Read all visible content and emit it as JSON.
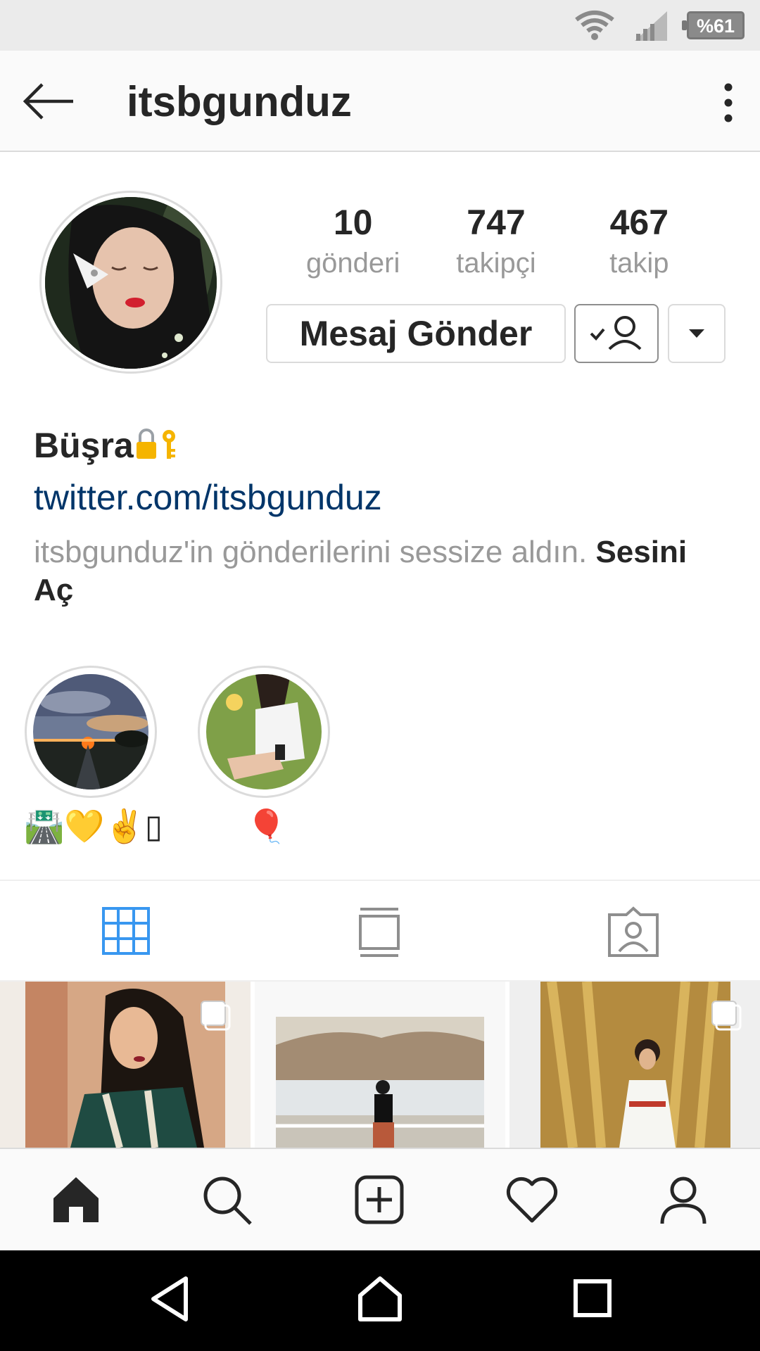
{
  "status_bar": {
    "battery": "%61",
    "icons": [
      "wifi-icon",
      "signal-icon",
      "battery-icon"
    ]
  },
  "header": {
    "username": "itsbgunduz",
    "back_icon": "arrow-left-icon",
    "menu_icon": "more-vertical-icon"
  },
  "profile": {
    "stats": [
      {
        "count": "10",
        "label": "gönderi"
      },
      {
        "count": "747",
        "label": "takipçi"
      },
      {
        "count": "467",
        "label": "takip"
      }
    ],
    "message_button": "Mesaj Gönder",
    "following_icon": "user-check-icon",
    "dropdown_icon": "caret-down-icon",
    "full_name": "Büşra",
    "name_emoji": "lock-key-emoji",
    "website": "twitter.com/itsbgunduz",
    "muted_text": "itsbgunduz'in gönderilerini sessize aldın.",
    "unmute_label": "Sesini Aç"
  },
  "highlights": [
    {
      "label": "🛣️💛✌️▯"
    },
    {
      "label": "🎈"
    }
  ],
  "tabs": [
    {
      "icon": "grid-icon",
      "active": true
    },
    {
      "icon": "feed-list-icon",
      "active": false
    },
    {
      "icon": "tagged-photos-icon",
      "active": false
    }
  ],
  "bottom_nav": [
    "home-icon",
    "search-icon",
    "add-post-icon",
    "heart-icon",
    "profile-icon"
  ],
  "system_nav": [
    "back-triangle-icon",
    "home-outline-icon",
    "recents-square-icon"
  ],
  "colors": {
    "accent": "#3897f0",
    "link": "#003569",
    "muted": "#999999",
    "border": "#dbdbdb"
  }
}
